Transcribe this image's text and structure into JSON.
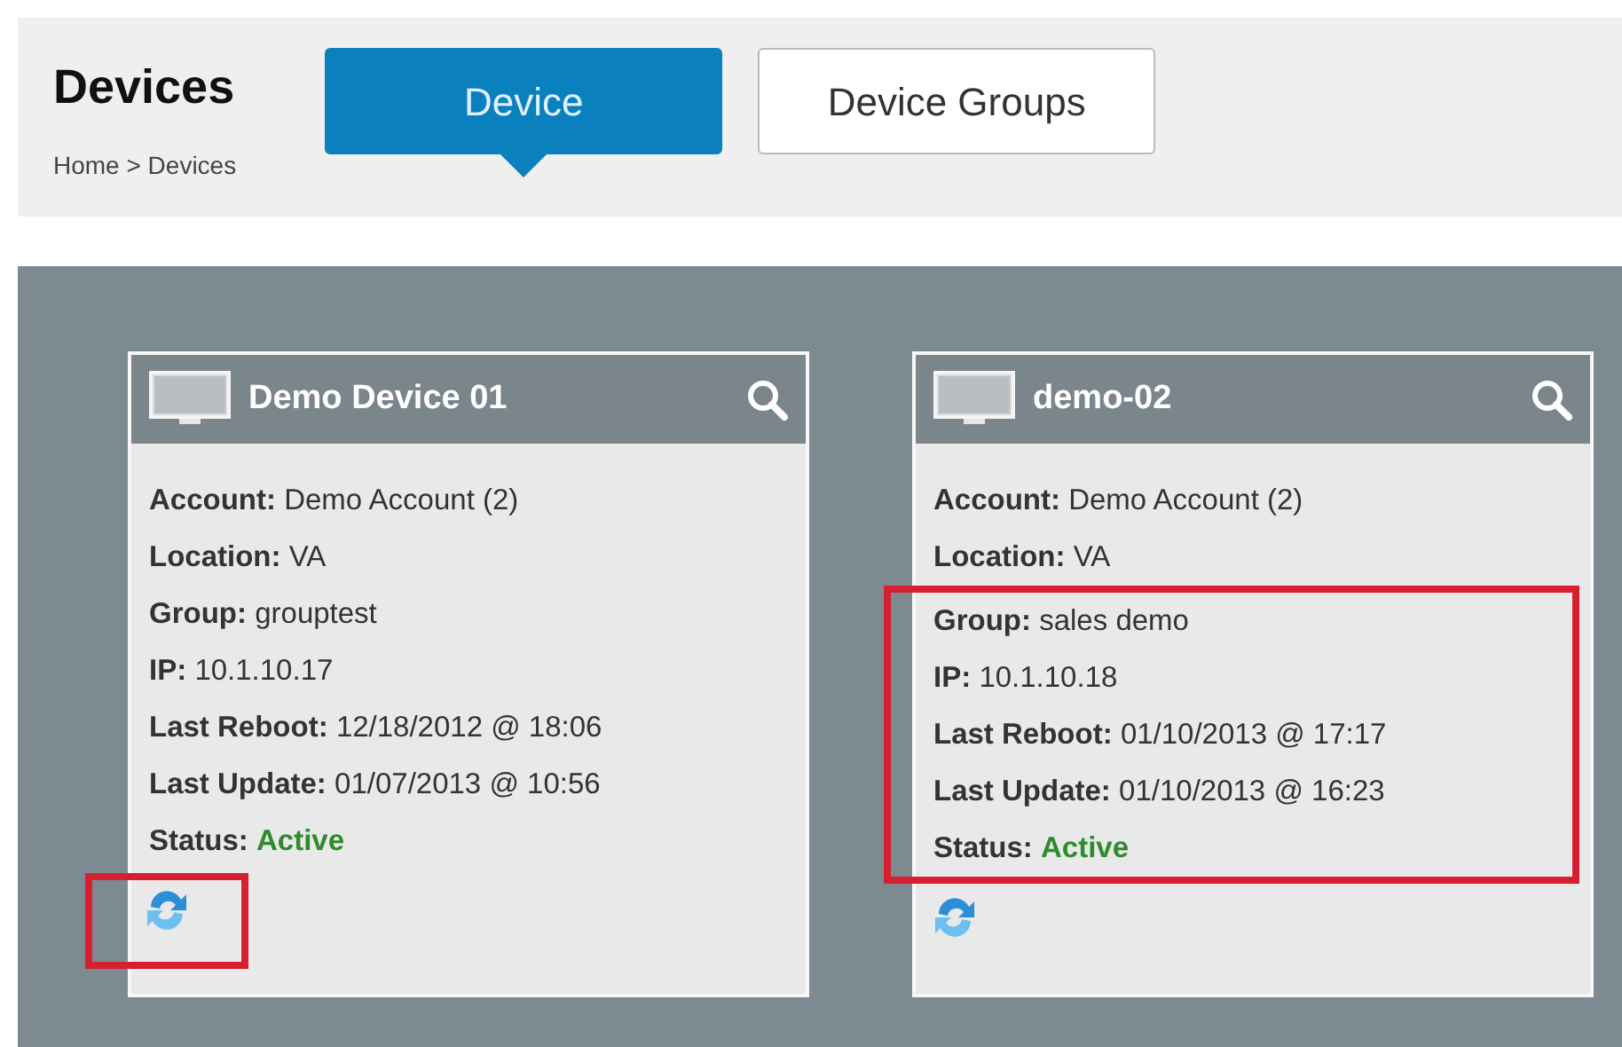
{
  "page": {
    "title": "Devices",
    "breadcrumb": "Home > Devices"
  },
  "tabs": [
    {
      "label": "Device",
      "selected": true
    },
    {
      "label": "Device Groups",
      "selected": false
    }
  ],
  "devices": [
    {
      "name": "Demo Device 01",
      "refresh_highlighted": true,
      "fields": [
        {
          "label": "Account:",
          "value": "Demo Account (2)",
          "kind": "text",
          "highlighted": false
        },
        {
          "label": "Location:",
          "value": "VA",
          "kind": "text",
          "highlighted": false
        },
        {
          "label": "Group:",
          "value": "grouptest",
          "kind": "text",
          "highlighted": false
        },
        {
          "label": "IP:",
          "value": "10.1.10.17",
          "kind": "text",
          "highlighted": false
        },
        {
          "label": "Last Reboot:",
          "value": "12/18/2012 @ 18:06",
          "kind": "text",
          "highlighted": false
        },
        {
          "label": "Last Update:",
          "value": "01/07/2013 @ 10:56",
          "kind": "text",
          "highlighted": false
        },
        {
          "label": "Status:",
          "value": "Active",
          "kind": "status",
          "highlighted": false
        }
      ]
    },
    {
      "name": "demo-02",
      "refresh_highlighted": false,
      "fields": [
        {
          "label": "Account:",
          "value": "Demo Account (2)",
          "kind": "text",
          "highlighted": false
        },
        {
          "label": "Location:",
          "value": "VA",
          "kind": "text",
          "highlighted": false
        },
        {
          "label": "Group:",
          "value": "sales demo",
          "kind": "text",
          "highlighted": true
        },
        {
          "label": "IP:",
          "value": "10.1.10.18",
          "kind": "text",
          "highlighted": true
        },
        {
          "label": "Last Reboot:",
          "value": "01/10/2013 @ 17:17",
          "kind": "text",
          "highlighted": true
        },
        {
          "label": "Last Update:",
          "value": "01/10/2013 @ 16:23",
          "kind": "text",
          "highlighted": true
        },
        {
          "label": "Status:",
          "value": "Active",
          "kind": "status",
          "highlighted": true
        }
      ]
    }
  ]
}
